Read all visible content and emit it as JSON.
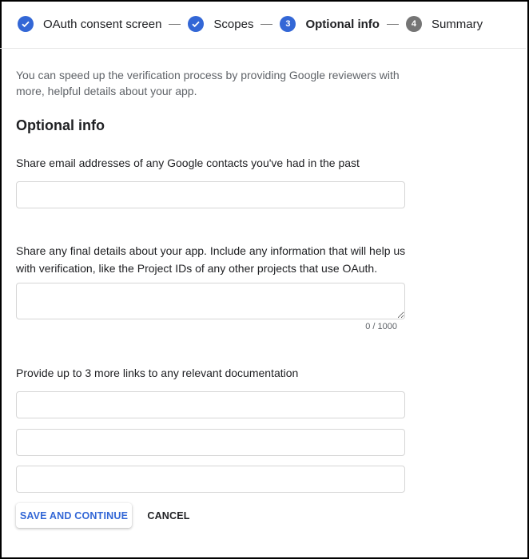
{
  "stepper": {
    "steps": [
      {
        "label": "OAuth consent screen",
        "state": "done",
        "icon": "check-icon"
      },
      {
        "label": "Scopes",
        "state": "done",
        "icon": "check-icon"
      },
      {
        "label": "Optional info",
        "state": "current",
        "number": "3"
      },
      {
        "label": "Summary",
        "state": "upcoming",
        "number": "4"
      }
    ],
    "colors": {
      "active": "#3367d6",
      "inactive": "#757575"
    }
  },
  "intro": "You can speed up the verification process by providing Google reviewers with more, helpful details about your app.",
  "section_title": "Optional info",
  "fields": {
    "email_label": "Share email addresses of any Google contacts you've had in the past",
    "email_value": "",
    "details_label": "Share any final details about your app. Include any information that will help us with verification, like the Project IDs of any other projects that use OAuth.",
    "details_value": "",
    "details_counter": "0 / 1000",
    "links_label": "Provide up to 3 more links to any relevant documentation",
    "links": [
      "",
      "",
      ""
    ]
  },
  "buttons": {
    "save": "SAVE AND CONTINUE",
    "cancel": "CANCEL"
  }
}
